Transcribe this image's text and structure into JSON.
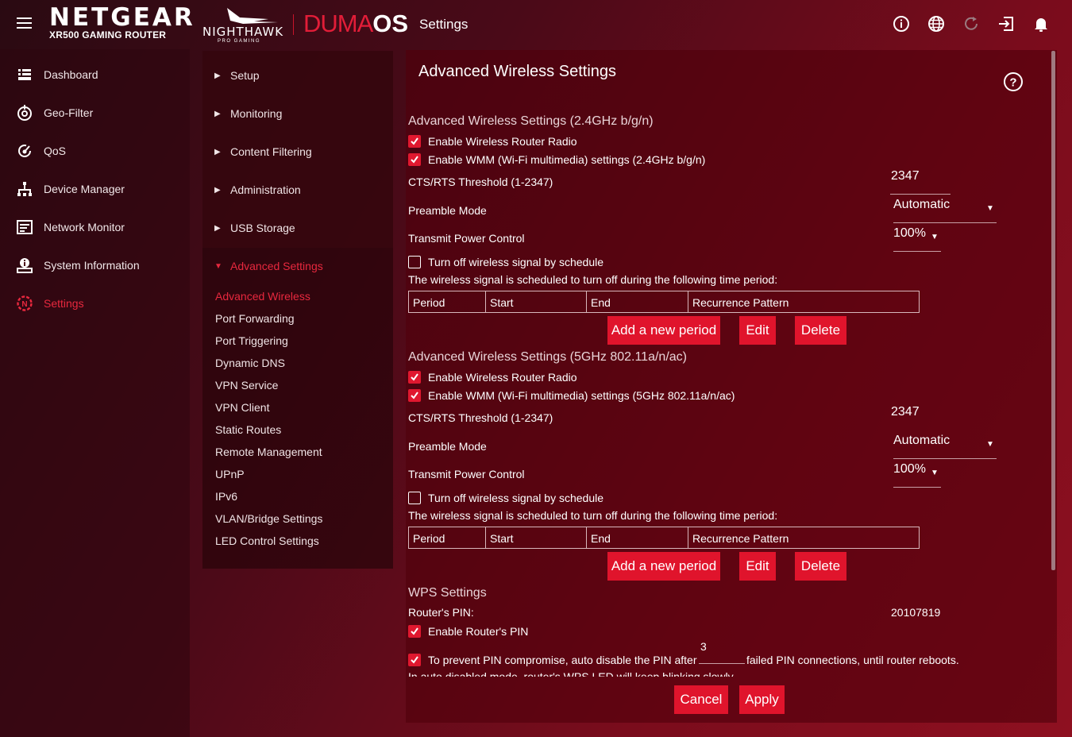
{
  "header": {
    "brand": "NETGEAR",
    "model": "XR500 GAMING ROUTER",
    "nighthawk": "NIGHTHAWK",
    "nighthawk_sub": "PRO GAMING",
    "duma_a": "DUMA",
    "duma_b": "OS",
    "page": "Settings"
  },
  "nav": {
    "items": [
      {
        "label": "Dashboard",
        "icon": "dashboard-icon"
      },
      {
        "label": "Geo-Filter",
        "icon": "geo-filter-icon"
      },
      {
        "label": "QoS",
        "icon": "qos-icon"
      },
      {
        "label": "Device Manager",
        "icon": "device-manager-icon"
      },
      {
        "label": "Network Monitor",
        "icon": "network-monitor-icon"
      },
      {
        "label": "System Information",
        "icon": "system-information-icon"
      },
      {
        "label": "Settings",
        "icon": "settings-icon",
        "active": true
      }
    ]
  },
  "submenu": {
    "heads": [
      "Setup",
      "Monitoring",
      "Content Filtering",
      "Administration",
      "USB Storage",
      "Advanced Settings"
    ],
    "items": [
      "Advanced Wireless",
      "Port Forwarding",
      "Port Triggering",
      "Dynamic DNS",
      "VPN Service",
      "VPN Client",
      "Static Routes",
      "Remote Management",
      "UPnP",
      "IPv6",
      "VLAN/Bridge Settings",
      "LED Control Settings"
    ]
  },
  "panel": {
    "title": "Advanced Wireless Settings",
    "band24": {
      "title": "Advanced Wireless Settings (2.4GHz b/g/n)",
      "enable_radio": "Enable Wireless Router Radio",
      "enable_wmm": "Enable WMM (Wi-Fi multimedia) settings (2.4GHz b/g/n)",
      "cts_label": "CTS/RTS Threshold (1-2347)",
      "cts_value": "2347",
      "preamble_label": "Preamble Mode",
      "preamble_value": "Automatic",
      "tx_label": "Transmit Power Control",
      "tx_value": "100%",
      "schedule_label": "Turn off wireless signal by schedule",
      "schedule_note": "The wireless signal is scheduled to turn off during the following time period:"
    },
    "band5": {
      "title": "Advanced Wireless Settings (5GHz 802.11a/n/ac)",
      "enable_radio": "Enable Wireless Router Radio",
      "enable_wmm": "Enable WMM (Wi-Fi multimedia) settings (5GHz 802.11a/n/ac)",
      "cts_label": "CTS/RTS Threshold (1-2347)",
      "cts_value": "2347",
      "preamble_label": "Preamble Mode",
      "preamble_value": "Automatic",
      "tx_label": "Transmit Power Control",
      "tx_value": "100%",
      "schedule_label": "Turn off wireless signal by schedule",
      "schedule_note": "The wireless signal is scheduled to turn off during the following time period:"
    },
    "table_headers": [
      "Period",
      "Start",
      "End",
      "Recurrence Pattern"
    ],
    "buttons": {
      "add": "Add a new period",
      "edit": "Edit",
      "delete": "Delete"
    },
    "wps": {
      "title": "WPS Settings",
      "pin_label": "Router's PIN:",
      "pin_value": "20107819",
      "enable_pin": "Enable Router's PIN",
      "prevent_a": "To prevent PIN compromise, auto disable the PIN after",
      "prevent_value": "3",
      "prevent_b": "failed PIN connections, until router reboots.",
      "clipped_note": "In auto disabled mode, router's WPS LED will keep blinking slowly"
    },
    "footer": {
      "cancel": "Cancel",
      "apply": "Apply"
    }
  },
  "colors": {
    "accent": "#e0142c",
    "active_text": "#e8283e"
  }
}
